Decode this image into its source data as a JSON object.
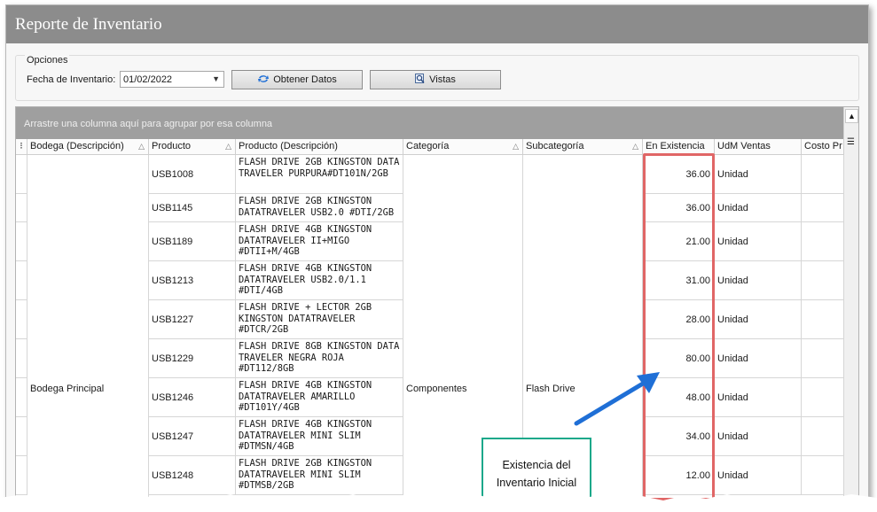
{
  "window": {
    "title": "Reporte de Inventario"
  },
  "opciones": {
    "legend": "Opciones",
    "fecha_label": "Fecha de Inventario:",
    "fecha_value": "01/02/2022",
    "obtener_label": "Obtener Datos",
    "vistas_label": "Vistas"
  },
  "grid": {
    "group_hint": "Arrastre una columna aquí para agrupar por esa columna",
    "columns": [
      "Bodega (Descripción)",
      "Producto",
      "Producto (Descripción)",
      "Categoría",
      "Subcategoría",
      "En Existencia",
      "UdM Ventas",
      "Costo Pr"
    ],
    "bodega": "Bodega Principal",
    "categoria": "Componentes",
    "subcategoria": "Flash Drive",
    "rows": [
      {
        "producto": "USB1008",
        "descripcion": "FLASH DRIVE 2GB KINGSTON DATA TRAVELER PURPURA#DT101N/2GB",
        "existencia": "36.00",
        "udm": "Unidad"
      },
      {
        "producto": "USB1145",
        "descripcion": "FLASH DRIVE 2GB KINGSTON DATATRAVELER USB2.0 #DTI/2GB",
        "existencia": "36.00",
        "udm": "Unidad"
      },
      {
        "producto": "USB1189",
        "descripcion": "FLASH DRIVE 4GB KINGSTON DATATRAVELER II+MIGO #DTII+M/4GB",
        "existencia": "21.00",
        "udm": "Unidad"
      },
      {
        "producto": "USB1213",
        "descripcion": "FLASH DRIVE 4GB KINGSTON DATATRAVELER USB2.0/1.1 #DTI/4GB",
        "existencia": "31.00",
        "udm": "Unidad"
      },
      {
        "producto": "USB1227",
        "descripcion": "FLASH DRIVE + LECTOR 2GB KINGSTON DATATRAVELER #DTCR/2GB",
        "existencia": "28.00",
        "udm": "Unidad"
      },
      {
        "producto": "USB1229",
        "descripcion": "FLASH DRIVE 8GB KINGSTON DATA TRAVELER NEGRA ROJA #DT112/8GB",
        "existencia": "80.00",
        "udm": "Unidad"
      },
      {
        "producto": "USB1246",
        "descripcion": "FLASH DRIVE 4GB KINGSTON DATATRAVELER AMARILLO #DT101Y/4GB",
        "existencia": "48.00",
        "udm": "Unidad"
      },
      {
        "producto": "USB1247",
        "descripcion": "FLASH DRIVE 4GB KINGSTON DATATRAVELER MINI SLIM #DTMSN/4GB",
        "existencia": "34.00",
        "udm": "Unidad"
      },
      {
        "producto": "USB1248",
        "descripcion": "FLASH DRIVE 2GB KINGSTON DATATRAVELER MINI SLIM #DTMSB/2GB",
        "existencia": "12.00",
        "udm": "Unidad"
      }
    ]
  },
  "callout": {
    "line1": "Existencia del",
    "line2": "Inventario Inicial"
  },
  "colors": {
    "highlight": "#e06666",
    "callout_border": "#1aa88a",
    "arrow": "#1f6fd6",
    "titlebar": "#8c8c8c"
  },
  "icons": {
    "obtener": "refresh-icon",
    "vistas": "magnifier-icon",
    "dropdown": "chevron-down-icon",
    "sort": "sort-triangle-icon"
  }
}
